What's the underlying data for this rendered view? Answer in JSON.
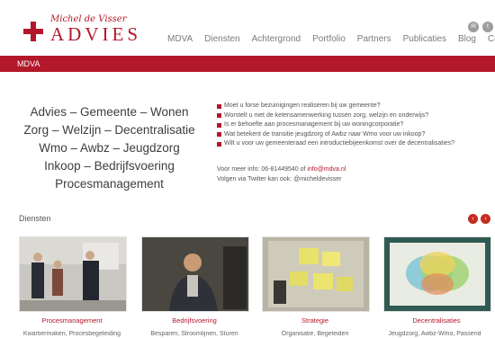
{
  "logo": {
    "script": "Michel de Visser",
    "main": "ADVIES"
  },
  "social": [
    {
      "icon": "social-icon-1"
    },
    {
      "icon": "social-icon-2"
    }
  ],
  "nav": [
    "MDVA",
    "Diensten",
    "Achtergrond",
    "Portfolio",
    "Partners",
    "Publicaties",
    "Blog",
    "Contact"
  ],
  "banner": {
    "label": "MDVA"
  },
  "headline": [
    "Advies – Gemeente – Wonen",
    "Zorg – Welzijn – Decentralisatie",
    "Wmo – Awbz – Jeugdzorg",
    "Inkoop – Bedrijfsvoering",
    "Procesmanagement"
  ],
  "bullets": [
    "Moet u forse bezuinigingen realiseren bij uw gemeente?",
    "Worstelt u met de ketensamenwerking tussen zorg, welzijn en onderwijs?",
    "Is er behoefte aan procesmanagement bij uw woningcorporatie?",
    "Wat betekent de transitie jeugdzorg of Awbz naar Wmo voor uw inkoop?",
    "Wilt u voor uw gemeenteraad een introductiebijeenkomst over de decentralisaties?"
  ],
  "contact": {
    "info_prefix": "Voor meer info: 06-81449540 of ",
    "email": "info@mdva.nl",
    "twitter": "Volgen via Twitter kan ook: @micheldevisser"
  },
  "diensten": {
    "title": "Diensten",
    "cards": [
      {
        "title": "Procesmanagement",
        "sub": "Kwartiermaken, Procesbegeleiding"
      },
      {
        "title": "Bedrijfsvoering",
        "sub": "Besparen, Stroomlijnen, Sturen"
      },
      {
        "title": "Strategie",
        "sub": "Organisatie, Begeleiden"
      },
      {
        "title": "Decentralisaties",
        "sub": "Jeugdzorg, Awbz-Wmo, Passend"
      }
    ]
  },
  "colors": {
    "accent": "#b3182a",
    "nav_text": "#7b7b7b"
  }
}
